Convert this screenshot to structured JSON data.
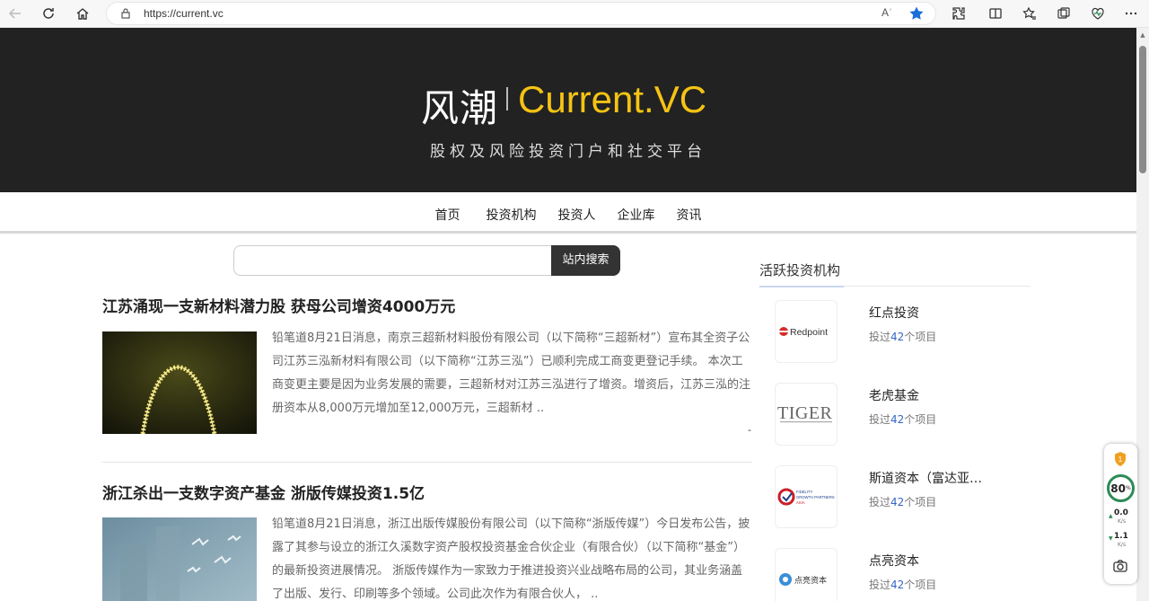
{
  "browser": {
    "url": "https://current.vc",
    "read_aloud_label": "Aʾ",
    "accent": "#1a6ed8"
  },
  "site": {
    "logo_cn": "风潮",
    "logo_en": "Current.VC",
    "slogan": "股权及风险投资门户和社交平台",
    "brand_color": "#f5c313",
    "nav": [
      "首页",
      "投资机构",
      "投资人",
      "企业库",
      "资讯"
    ]
  },
  "search": {
    "placeholder": "",
    "button_label": "站内搜索"
  },
  "articles": [
    {
      "title": "江苏涌现一支新材料潜力股 获母公司增资4000万元",
      "summary": "铅笔道8月21日消息，南京三超新材料股份有限公司（以下简称“三超新材”）宣布其全资子公司江苏三泓新材料有限公司（以下简称“江苏三泓”）已顺利完成工商变更登记手续。 本次工商变更主要是因为业务发展的需要，三超新材对江苏三泓进行了增资。增资后，江苏三泓的注册资本从8,000万元增加至12,000万元，三超新材 ..",
      "more_mark": "-"
    },
    {
      "title": "浙江杀出一支数字资产基金 浙版传媒投资1.5亿",
      "summary": "铅笔道8月21日消息，浙江出版传媒股份有限公司（以下简称“浙版传媒”）今日发布公告，披露了其参与设立的浙江久溪数字资产股权投资基金合伙企业（有限合伙）（以下简称“基金”）的最新投资进展情况。 浙版传媒作为一家致力于推进投资兴业战略布局的公司，其业务涵盖了出版、发行、印刷等多个领域。公司此次作为有限合伙人， .."
    }
  ],
  "sidebar": {
    "title": "活跃投资机构",
    "orgs": [
      {
        "name": "红点投资",
        "meta_prefix": "投过",
        "count": "42",
        "meta_suffix": "个项目",
        "logo_text": "Redpoint"
      },
      {
        "name": "老虎基金",
        "meta_prefix": "投过",
        "count": "42",
        "meta_suffix": "个项目",
        "logo_text": "TIGER"
      },
      {
        "name": "斯道资本（富达亚…",
        "meta_prefix": "投过",
        "count": "42",
        "meta_suffix": "个项目",
        "logo_text": "FIDELITY GROWTH PARTNERS ASIA"
      },
      {
        "name": "点亮资本",
        "meta_prefix": "投过",
        "count": "42",
        "meta_suffix": "个项目",
        "logo_text": "点亮资本"
      }
    ]
  },
  "widget": {
    "badge": "1",
    "score": "80",
    "score_unit": "%",
    "up_speed": "0.0",
    "down_speed": "1.1",
    "speed_unit": "K/s"
  }
}
